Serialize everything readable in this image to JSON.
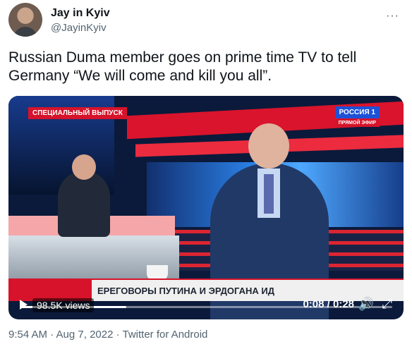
{
  "author": {
    "name": "Jay in Kyiv",
    "handle": "@JayinKyiv"
  },
  "more_menu_label": "···",
  "tweet": {
    "text": "Russian Duma member goes on prime time TV to tell Germany “We will come and kill you all”."
  },
  "video": {
    "overlay_tag": "СПЕЦИАЛЬНЫЙ ВЫПУСК",
    "channel_logo": "РОССИЯ 1",
    "live_label": "ПРЯМОЙ ЭФИР",
    "ticker_text": "ЕРЕГОВОРЫ ПУТИНА И ЭРДОГАНА ИД",
    "views": "98.5K views",
    "time_display": "0:08 / 0:28",
    "progress_fraction": 0.286
  },
  "footer": {
    "meta": "9:54 AM · Aug 7, 2022 · Twitter for Android"
  }
}
